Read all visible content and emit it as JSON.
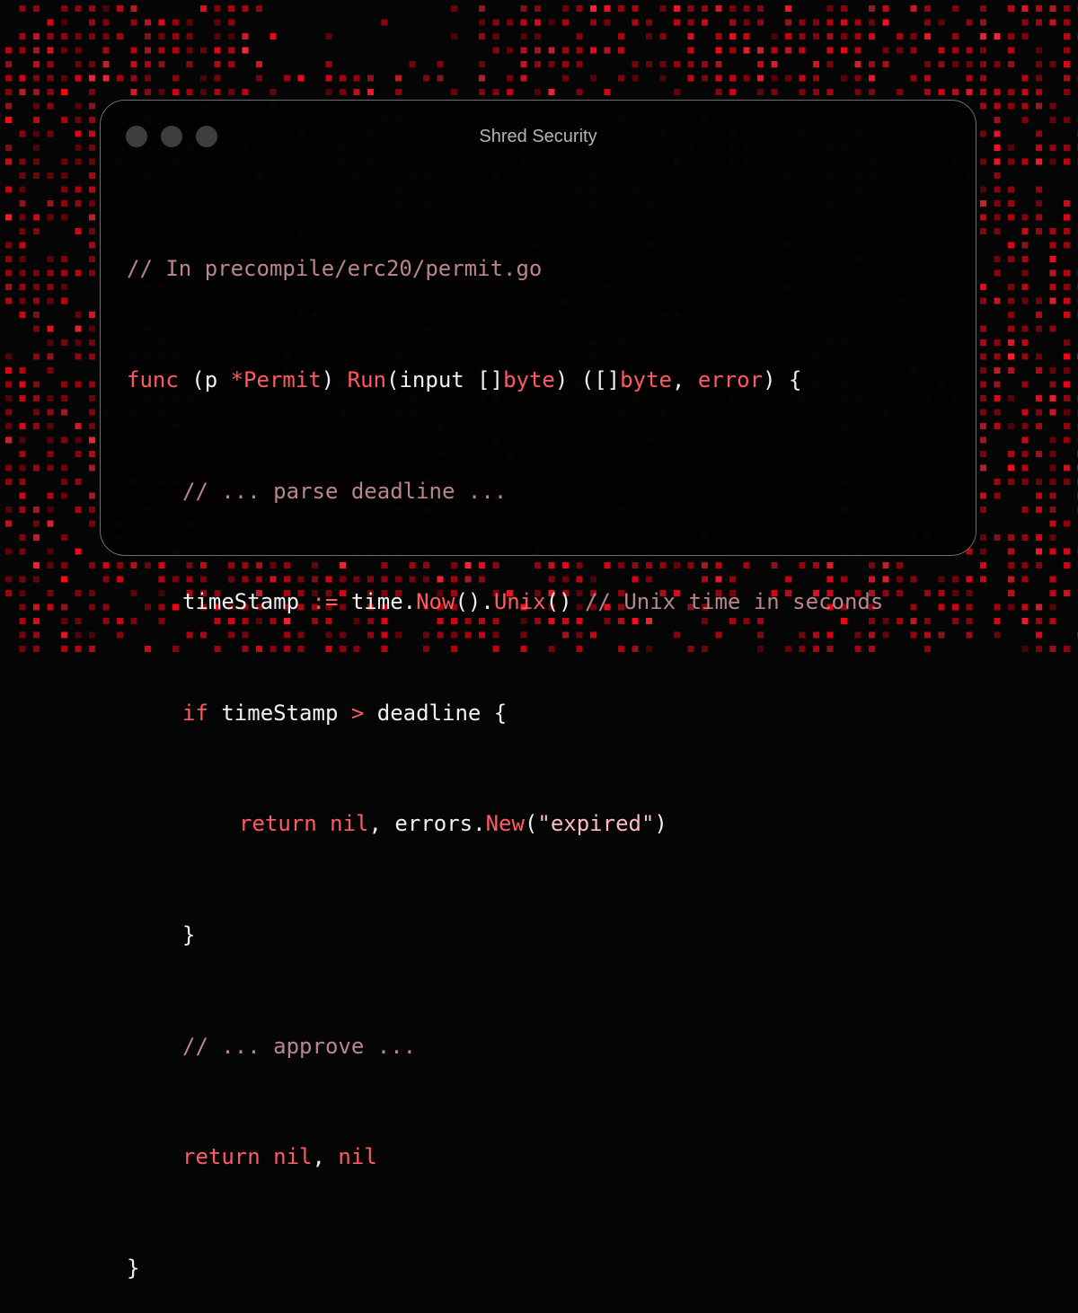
{
  "window": {
    "title": "Shred Security"
  },
  "code": {
    "comment_header": "// In precompile/erc20/permit.go",
    "func_kw": "func",
    "open_paren": " (p ",
    "receiver_type": "*Permit",
    "close_paren": ") ",
    "method_name": "Run",
    "params": "(input []",
    "byte_kw1": "byte",
    "returns_open": ") ([]",
    "byte_kw2": "byte",
    "comma": ", ",
    "error_kw": "error",
    "brace_open": ") {",
    "comment_parse": "// ... parse deadline ...",
    "ts_var": "timeStamp ",
    "assign_op": ":=",
    "time_pkg": " time.",
    "now_fn": "Now",
    "dot_call": "().",
    "unix_fn": "Unix",
    "call_end": "() ",
    "comment_unix": "// Unix time in seconds",
    "if_kw": "if",
    "if_ts": " timeStamp ",
    "gt_op": ">",
    "if_rest": " deadline {",
    "return_kw1": "return",
    "sp1": " ",
    "nil_kw1": "nil",
    "errors_pkg": ", errors.",
    "new_fn": "New",
    "paren_open": "(",
    "expired_str": "\"expired\"",
    "paren_close": ")",
    "inner_close": "}",
    "comment_approve": "// ... approve ...",
    "return_kw2": "return",
    "sp2": " ",
    "nil_kw2": "nil",
    "nil_sep": ", ",
    "nil_kw3": "nil",
    "func_close": "}"
  },
  "colors": {
    "background": "#050505",
    "accent_red": "#ff5a62",
    "comment": "#b9868a",
    "string": "#ffbcc0",
    "text": "#f1f1f1"
  }
}
